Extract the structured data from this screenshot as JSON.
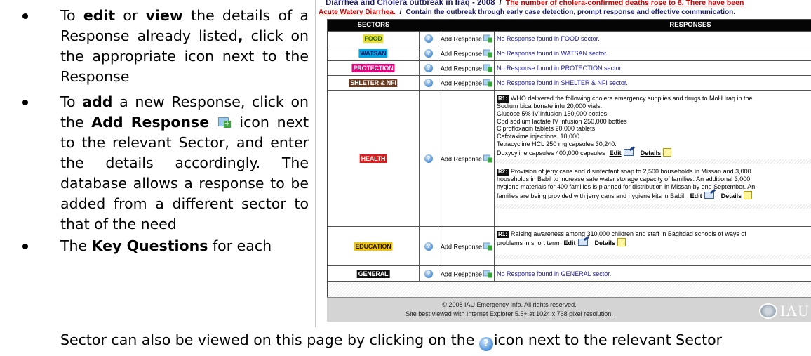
{
  "instructions": {
    "b1": {
      "pre1": "To ",
      "edit": "edit",
      "mid1": " or ",
      "view": "view",
      "post1": " the details of a Response already listed",
      "comma": ",",
      "post2": "  click on the appropriate icon next to the Response"
    },
    "b2": {
      "pre1": "To ",
      "add": "add",
      "post1": " a new Response, click on the ",
      "addresp": "Add Response",
      "post2": " icon next to the relevant Sector, and enter the details accordingly. The database allows a response to be added from a different sector to that of the need"
    },
    "b3": {
      "pre1": "The ",
      "kq": "Key Questions",
      "post1": " for each"
    },
    "last_line_a": "Sector can also be viewed on this page by clicking on the ",
    "last_line_b": "icon next to the relevant Sector"
  },
  "panel": {
    "title": "Diarrhea and Cholera outbreak in Iraq - 2008",
    "sep": "/",
    "alert": "The number of cholera-confirmed deaths rose to 8. There have been",
    "need": "Acute Watery Diarrhea.",
    "objective": "Contain the outbreak through early case detection, prompt response and effective communication.",
    "col_sectors": "SECTORS",
    "col_responses": "RESPONSES",
    "add_label": "Add Response",
    "q_glyph": "?",
    "edit_label": "Edit",
    "details_label": "Details",
    "footer_copyright": "© 2008 IAU Emergency Info. All rights reserved.",
    "footer_browser": "Site best viewed with Internet Explorer 5.5+ at 1024 x 768 pixel resolution.",
    "logo_text": "IAU"
  },
  "rows": [
    {
      "sector": "FOOD",
      "bg": "#e8e02a",
      "fg": "#2a6b1a",
      "response": "No Response found in FOOD sector."
    },
    {
      "sector": "WATSAN",
      "bg": "#00a6e6",
      "fg": "#0a1a5a",
      "response": "No Response found in WATSAN sector."
    },
    {
      "sector": "PROTECTION",
      "bg": "#e6007e",
      "fg": "#ffffff",
      "response": "No Response found in PROTECTION sector."
    },
    {
      "sector": "SHLETER & NFI",
      "bg": "#6b3a1f",
      "fg": "#ffffff",
      "response": "No Response found in SHELTER & NFI sector."
    },
    {
      "sector": "HEALTH",
      "bg": "#d81e1e",
      "fg": "#ffffff",
      "r1_tag": "R1:",
      "r1_lines": [
        "WHO delivered the following cholera emergency supplies and drugs to MoH Iraq in the",
        "Sodium bicarbonate infu 20,000 vials.",
        "Glucose 5% IV infusion 150,000 bottles.",
        "Cpd sodium lactate IV infusion 250,000 bottles",
        "Ciprofloxacin tablets 20,000 tablets",
        "Cefotaxime injections. 10,000",
        "Tetracycline HCL 250 mg capsules 30,240.",
        "Doxycyline capsules 400,000 capsules"
      ],
      "r2_tag": "R2:",
      "r2_lines": [
        "Provision of jerry cans and disinfectant soap to 2,500 households in Missan and 3,000",
        "households in Babil to increase safe water storage capacity of families. An additional 3,000",
        "hygiene materials for 400 families is planned for distribution in Missan by end September. An",
        "families are being provided with jerry cans and hygiene kits in Babil."
      ]
    },
    {
      "sector": "EDUCATION",
      "bg": "#f5c400",
      "fg": "#1a1a1a",
      "r1_tag": "R1:",
      "r1_lines": [
        "Raising awareness among 310,000 children and staff in Baghdad schools of ways of",
        "problems in short term"
      ]
    },
    {
      "sector": "GENERAL",
      "bg": "#111111",
      "fg": "#ffffff",
      "response": "No Response found in GENERAL sector."
    }
  ]
}
